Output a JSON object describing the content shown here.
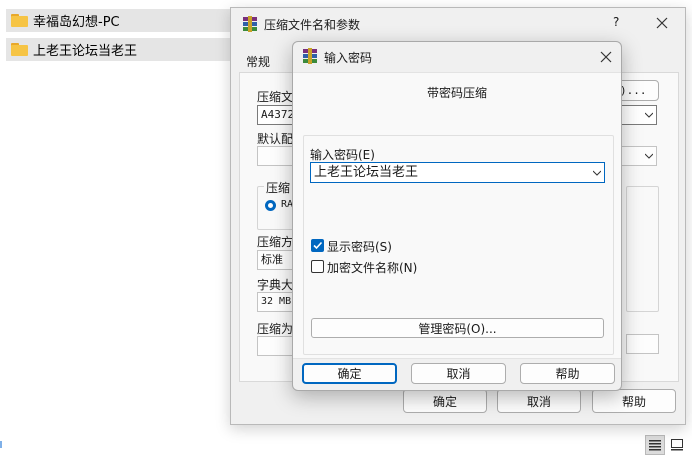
{
  "explorer": {
    "items": [
      {
        "label": "幸福岛幻想-PC",
        "icon": "folder-icon"
      },
      {
        "label": "上老王论坛当老王",
        "icon": "folder-icon"
      }
    ]
  },
  "back_dialog": {
    "title": "压缩文件名和参数",
    "help_char": "?",
    "tab": "常规",
    "archive_name_label": "压缩文",
    "archive_name_value": "A4372.",
    "browse_fragment": "B)...",
    "profile_label": "默认配",
    "format_group_label": "压缩",
    "format_option": "RA",
    "method_label": "压缩方",
    "method_value": "标准",
    "dict_label": "字典大",
    "dict_value": "32 MB",
    "split_label": "压缩为",
    "buttons": {
      "ok": "确定",
      "cancel": "取消",
      "help": "帮助"
    }
  },
  "password_dialog": {
    "title": "输入密码",
    "subtitle": "带密码压缩",
    "password_label": "输入密码(E)",
    "password_value": "上老王论坛当老王",
    "show_password": {
      "label": "显示密码(S)",
      "checked": true
    },
    "encrypt_names": {
      "label": "加密文件名称(N)",
      "checked": false
    },
    "manage_button": "管理密码(O)...",
    "buttons": {
      "ok": "确定",
      "cancel": "取消",
      "help": "帮助"
    }
  },
  "colors": {
    "accent": "#0067c0",
    "folder": "#f6c444",
    "dialog_bg": "#f0f0f0"
  }
}
